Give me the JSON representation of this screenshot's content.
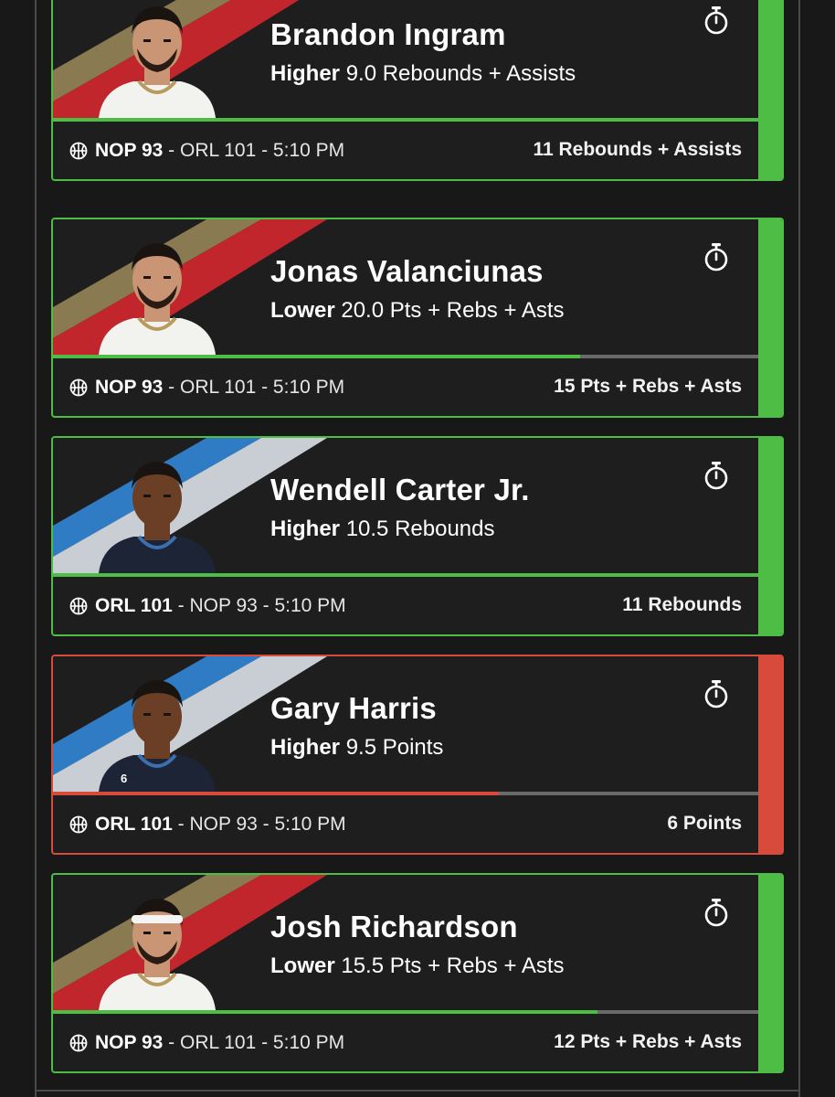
{
  "colors": {
    "win": "#4ebd45",
    "loss": "#d84a3c",
    "track": "#6a6a6a",
    "nop_gold": "#8a7a52",
    "nop_red": "#c1262c",
    "orl_blue": "#2f7bc4",
    "orl_silver": "#c9ced4"
  },
  "cards": [
    {
      "player": "Brandon Ingram",
      "direction": "Higher",
      "line": "9.0 Rebounds + Assists",
      "team": "NOP 93",
      "opponent": " - ORL 101 - 5:10 PM",
      "result": "11 Rebounds + Assists",
      "status": "win",
      "progress": 1.0,
      "team_colors": "nop",
      "jersey_number": "",
      "icon": "stopwatch-icon",
      "sport_icon": "basketball-icon"
    },
    {
      "player": "Jonas Valanciunas",
      "direction": "Lower",
      "line": "20.0 Pts + Rebs + Asts",
      "team": "NOP 93",
      "opponent": " - ORL 101 - 5:10 PM",
      "result": "15 Pts + Rebs + Asts",
      "status": "win",
      "progress": 0.745,
      "team_colors": "nop",
      "jersey_number": "",
      "icon": "stopwatch-icon",
      "sport_icon": "basketball-icon"
    },
    {
      "player": "Wendell Carter Jr.",
      "direction": "Higher",
      "line": "10.5 Rebounds",
      "team": "ORL 101",
      "opponent": " - NOP 93 - 5:10 PM",
      "result": "11 Rebounds",
      "status": "win",
      "progress": 1.0,
      "team_colors": "orl",
      "jersey_number": "",
      "icon": "stopwatch-icon",
      "sport_icon": "basketball-icon"
    },
    {
      "player": "Gary Harris",
      "direction": "Higher",
      "line": "9.5 Points",
      "team": "ORL 101",
      "opponent": " - NOP 93 - 5:10 PM",
      "result": "6 Points",
      "status": "loss",
      "progress": 0.63,
      "team_colors": "orl",
      "jersey_number": "6",
      "icon": "stopwatch-icon",
      "sport_icon": "basketball-icon"
    },
    {
      "player": "Josh Richardson",
      "direction": "Lower",
      "line": "15.5 Pts + Rebs + Asts",
      "team": "NOP 93",
      "opponent": " - ORL 101 - 5:10 PM",
      "result": "12 Pts + Rebs + Asts",
      "status": "win",
      "progress": 0.77,
      "team_colors": "nop",
      "jersey_number": "",
      "icon": "stopwatch-icon",
      "sport_icon": "basketball-icon"
    }
  ]
}
